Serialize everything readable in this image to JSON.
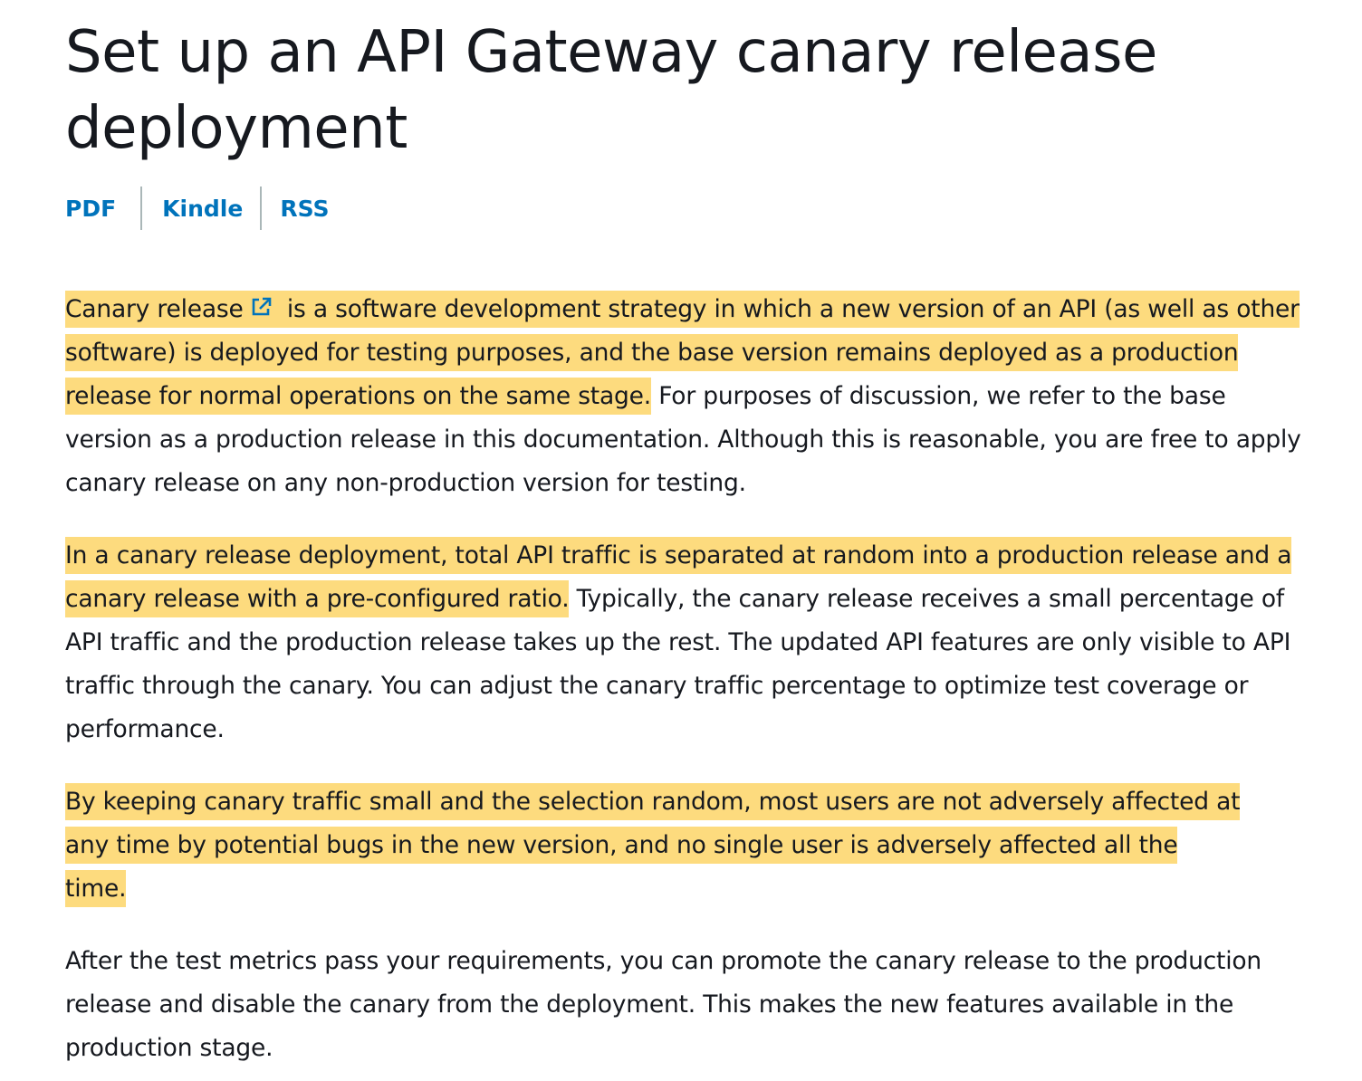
{
  "title": "Set up an API Gateway canary release deployment",
  "doc_links": [
    "PDF",
    "Kindle",
    "RSS"
  ],
  "colors": {
    "highlight": "#fddb7e",
    "link": "#0073bb",
    "text": "#16191f",
    "separator": "#aab7b8"
  },
  "icons": {
    "external_link": "external-link-icon"
  },
  "paragraphs": {
    "p1": {
      "link_text": "Canary release",
      "highlight_rest": " is a software development strategy in which a new version of an API (as well as other software) is deployed for testing purposes, and the base version remains deployed as a production release for normal operations on the same stage.",
      "plain": " For purposes of discussion, we refer to the base version as a production release in this documentation. Although this is reasonable, you are free to apply canary release on any non-production version for testing."
    },
    "p2": {
      "highlight": "In a canary release deployment, total API traffic is separated at random into a production release and a canary release with a pre-configured ratio.",
      "plain": " Typically, the canary release receives a small percentage of API traffic and the production release takes up the rest. The updated API features are only visible to API traffic through the canary. You can adjust the canary traffic percentage to optimize test coverage or performance."
    },
    "p3": {
      "highlight": "By keeping canary traffic small and the selection random, most users are not adversely affected at any time by potential bugs in the new version, and no single user is adversely affected all the time."
    },
    "p4": {
      "plain": "After the test metrics pass your requirements, you can promote the canary release to the production release and disable the canary from the deployment. This makes the new features available in the production stage."
    }
  }
}
